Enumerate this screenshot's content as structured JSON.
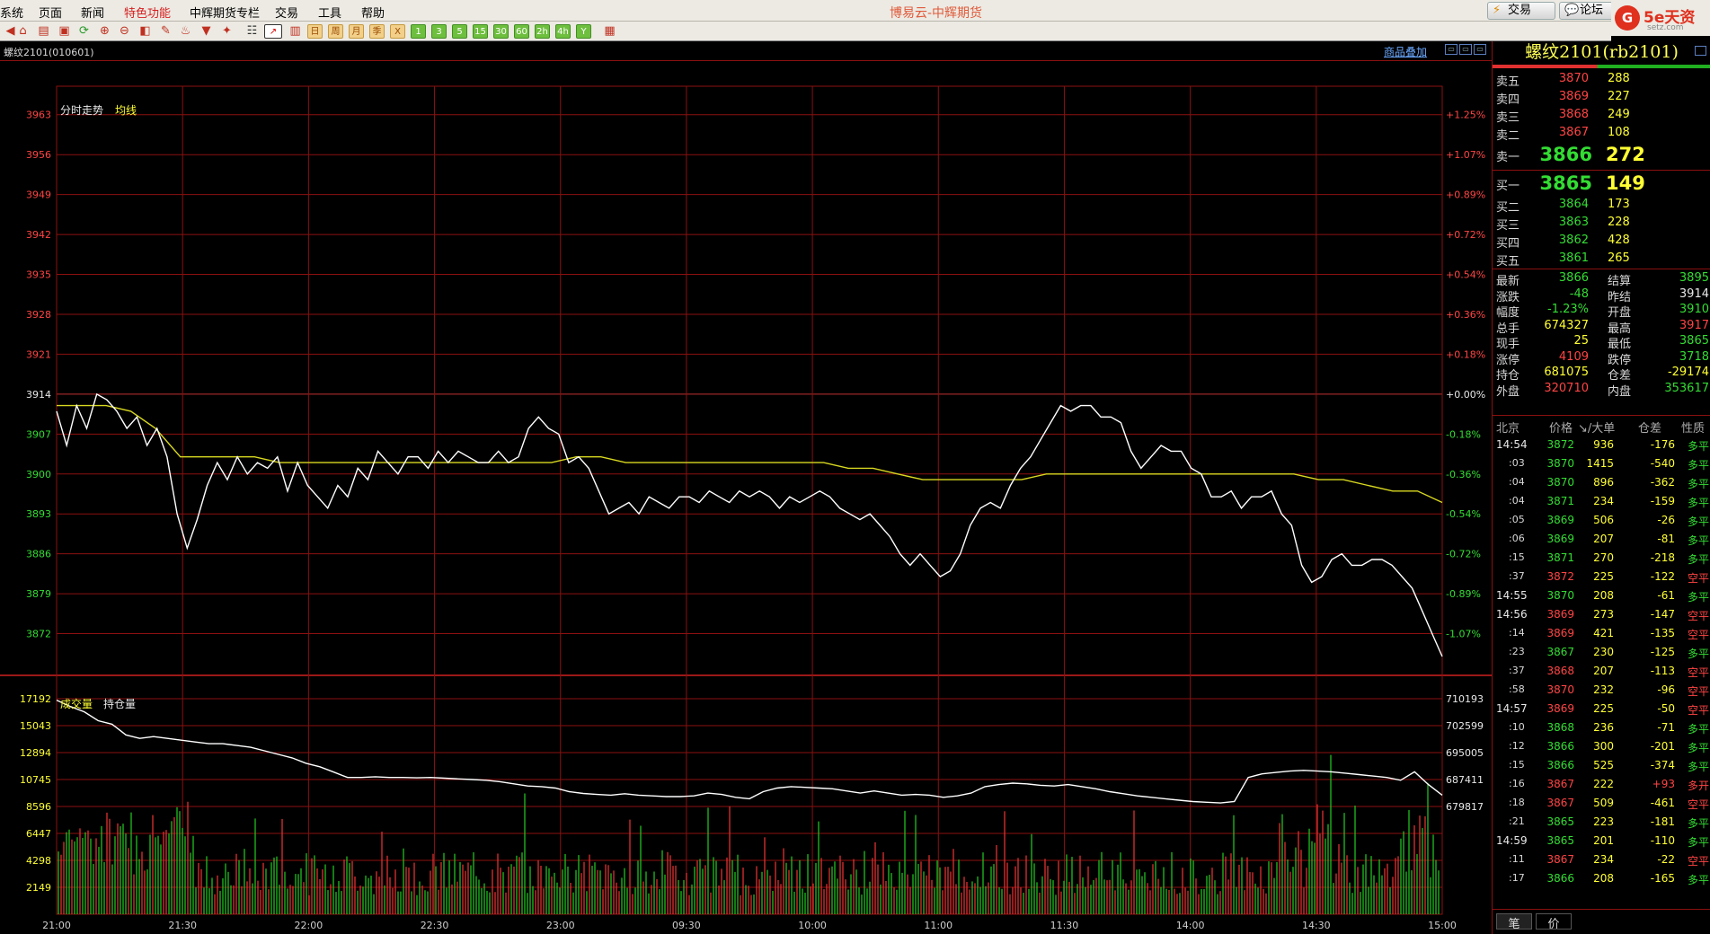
{
  "menu": {
    "items": [
      "系统",
      "页面",
      "新闻",
      "特色功能",
      "中辉期货专栏",
      "交易",
      "工具",
      "帮助"
    ],
    "app_title": "博易云-中辉期货",
    "trade_btn": "交易",
    "forum_btn": "论坛",
    "logo_brand": "5e天资",
    "logo_site": "setz.com"
  },
  "toolbar": {
    "period_buttons": [
      "日",
      "周",
      "月",
      "季",
      "X",
      "1",
      "3",
      "5",
      "15",
      "30",
      "60",
      "2h",
      "4h",
      "Y"
    ]
  },
  "chart": {
    "contract_code": "螺纹2101(010601)",
    "overlay_link": "商品叠加",
    "price_label": "分时走势",
    "avg_label": "均线",
    "volume_label": "成交量",
    "oi_label": "持仓量"
  },
  "chart_data": {
    "type": "line",
    "title": "",
    "price_axis_ticks": [
      "3963",
      "3956",
      "3949",
      "3942",
      "3935",
      "3928",
      "3921",
      "3914",
      "3907",
      "3900",
      "3893",
      "3886",
      "3879",
      "3872"
    ],
    "percent_axis_ticks": [
      "+1.25%",
      "+1.07%",
      "+0.89%",
      "+0.72%",
      "+0.54%",
      "+0.36%",
      "+0.18%",
      "+0.00%",
      "-0.18%",
      "-0.36%",
      "-0.54%",
      "-0.72%",
      "-0.89%",
      "-1.07%"
    ],
    "ylim": [
      3865,
      3968
    ],
    "prev_settle": 3914,
    "volume_axis_ticks": [
      "17192",
      "15043",
      "12894",
      "10745",
      "8596",
      "6447",
      "4298",
      "2149"
    ],
    "oi_axis_ticks": [
      "710193",
      "702599",
      "695005",
      "687411",
      "679817"
    ],
    "time_axis_ticks": [
      "21:00",
      "21:30",
      "22:00",
      "22:30",
      "23:00",
      "09:30",
      "10:00",
      "11:00",
      "11:30",
      "14:00",
      "14:30",
      "15:00"
    ],
    "series": [
      {
        "name": "分时走势",
        "values": [
          3911,
          3905,
          3912,
          3908,
          3914,
          3913,
          3911,
          3908,
          3910,
          3905,
          3908,
          3903,
          3893,
          3887,
          3892,
          3898,
          3902,
          3899,
          3903,
          3900,
          3902,
          3901,
          3903,
          3897,
          3902,
          3898,
          3896,
          3894,
          3898,
          3896,
          3901,
          3899,
          3904,
          3902,
          3900,
          3903,
          3903,
          3901,
          3904,
          3902,
          3904,
          3903,
          3902,
          3902,
          3904,
          3902,
          3903,
          3908,
          3910,
          3908,
          3907,
          3902,
          3903,
          3901,
          3897,
          3893,
          3894,
          3895,
          3893,
          3896,
          3895,
          3894,
          3896,
          3896,
          3895,
          3897,
          3896,
          3895,
          3897,
          3896,
          3897,
          3896,
          3894,
          3896,
          3895,
          3896,
          3897,
          3896,
          3894,
          3893,
          3892,
          3893,
          3891,
          3889,
          3886,
          3884,
          3886,
          3884,
          3882,
          3883,
          3886,
          3891,
          3894,
          3895,
          3894,
          3898,
          3901,
          3903,
          3906,
          3909,
          3912,
          3911,
          3912,
          3912,
          3910,
          3910,
          3909,
          3904,
          3901,
          3903,
          3905,
          3904,
          3904,
          3901,
          3900,
          3896,
          3896,
          3897,
          3894,
          3896,
          3896,
          3897,
          3893,
          3891,
          3884,
          3881,
          3882,
          3885,
          3886,
          3884,
          3884,
          3885,
          3885,
          3884,
          3882,
          3880,
          3876,
          3872,
          3868
        ]
      },
      {
        "name": "均线",
        "values": [
          3912,
          3912,
          3912,
          3911,
          3908,
          3903,
          3903,
          3903,
          3903,
          3902,
          3902,
          3902,
          3902,
          3902,
          3902,
          3902,
          3902,
          3902,
          3902,
          3902,
          3902,
          3903,
          3903,
          3902,
          3902,
          3902,
          3902,
          3902,
          3902,
          3902,
          3902,
          3902,
          3901,
          3901,
          3900,
          3899,
          3899,
          3899,
          3899,
          3899,
          3900,
          3900,
          3900,
          3900,
          3900,
          3900,
          3900,
          3900,
          3900,
          3900,
          3900,
          3899,
          3899,
          3898,
          3897,
          3897,
          3895
        ]
      },
      {
        "name": "持仓量",
        "values": [
          709800,
          708000,
          706500,
          704000,
          703000,
          700000,
          699000,
          699500,
          699000,
          698500,
          698000,
          697500,
          697500,
          697000,
          696500,
          695500,
          694500,
          693500,
          692000,
          691000,
          689500,
          688000,
          688000,
          688200,
          688000,
          688000,
          687900,
          688000,
          687800,
          687600,
          687400,
          687200,
          686800,
          686200,
          685600,
          685400,
          685000,
          684000,
          683500,
          683200,
          683000,
          683400,
          683000,
          682800,
          682600,
          682600,
          682800,
          683600,
          683200,
          682400,
          682000,
          684000,
          685000,
          685400,
          685200,
          685000,
          684800,
          684200,
          683600,
          684200,
          683600,
          683000,
          683200,
          683000,
          682400,
          682800,
          683600,
          685400,
          686000,
          686400,
          686200,
          685800,
          685600,
          686000,
          685400,
          684800,
          684000,
          683400,
          682800,
          682400,
          682000,
          681600,
          681200,
          681000,
          680800,
          681200,
          688000,
          689000,
          689400,
          689800,
          690000,
          689800,
          689600,
          689200,
          688800,
          688400,
          688000,
          687200,
          689600,
          686000,
          683000
        ]
      }
    ]
  },
  "panel": {
    "title": "螺纹2101(rb2101)",
    "asks": [
      {
        "label": "卖五",
        "price": "3870",
        "vol": "288"
      },
      {
        "label": "卖四",
        "price": "3869",
        "vol": "227"
      },
      {
        "label": "卖三",
        "price": "3868",
        "vol": "249"
      },
      {
        "label": "卖二",
        "price": "3867",
        "vol": "108"
      },
      {
        "label": "卖一",
        "price": "3866",
        "vol": "272"
      }
    ],
    "bids": [
      {
        "label": "买一",
        "price": "3865",
        "vol": "149"
      },
      {
        "label": "买二",
        "price": "3864",
        "vol": "173"
      },
      {
        "label": "买三",
        "price": "3863",
        "vol": "228"
      },
      {
        "label": "买四",
        "price": "3862",
        "vol": "428"
      },
      {
        "label": "买五",
        "price": "3861",
        "vol": "265"
      }
    ],
    "quote": [
      {
        "l1": "最新",
        "v1": "3866",
        "c1": "g",
        "l2": "结算",
        "v2": "3895",
        "c2": "g"
      },
      {
        "l1": "涨跌",
        "v1": "-48",
        "c1": "g",
        "l2": "昨结",
        "v2": "3914",
        "c2": "w"
      },
      {
        "l1": "幅度",
        "v1": "-1.23%",
        "c1": "g",
        "l2": "开盘",
        "v2": "3910",
        "c2": "g"
      },
      {
        "l1": "总手",
        "v1": "674327",
        "c1": "y",
        "l2": "最高",
        "v2": "3917",
        "c2": "r"
      },
      {
        "l1": "现手",
        "v1": "25",
        "c1": "y",
        "l2": "最低",
        "v2": "3865",
        "c2": "g"
      },
      {
        "l1": "涨停",
        "v1": "4109",
        "c1": "r",
        "l2": "跌停",
        "v2": "3718",
        "c2": "g"
      },
      {
        "l1": "持仓",
        "v1": "681075",
        "c1": "y",
        "l2": "仓差",
        "v2": "-29174",
        "c2": "y"
      },
      {
        "l1": "外盘",
        "v1": "320710",
        "c1": "r",
        "l2": "内盘",
        "v2": "353617",
        "c2": "g"
      }
    ],
    "tick_header": {
      "time": "北京",
      "price": "价格",
      "vol": "↘/大单",
      "oi": "仓差",
      "nature": "性质"
    },
    "ticks": [
      {
        "t": "14:54",
        "sub": false,
        "p": "3872",
        "pc": "g",
        "v": "936",
        "d": "-176",
        "dc": "y",
        "n": "多平",
        "nc": "g"
      },
      {
        "t": ":03",
        "sub": true,
        "p": "3870",
        "pc": "g",
        "v": "1415",
        "d": "-540",
        "dc": "y",
        "n": "多平",
        "nc": "g"
      },
      {
        "t": ":04",
        "sub": true,
        "p": "3870",
        "pc": "g",
        "v": "896",
        "d": "-362",
        "dc": "y",
        "n": "多平",
        "nc": "g"
      },
      {
        "t": ":04",
        "sub": true,
        "p": "3871",
        "pc": "g",
        "v": "234",
        "d": "-159",
        "dc": "y",
        "n": "多平",
        "nc": "g"
      },
      {
        "t": ":05",
        "sub": true,
        "p": "3869",
        "pc": "g",
        "v": "506",
        "d": "-26",
        "dc": "y",
        "n": "多平",
        "nc": "g"
      },
      {
        "t": ":06",
        "sub": true,
        "p": "3869",
        "pc": "g",
        "v": "207",
        "d": "-81",
        "dc": "y",
        "n": "多平",
        "nc": "g"
      },
      {
        "t": ":15",
        "sub": true,
        "p": "3871",
        "pc": "g",
        "v": "270",
        "d": "-218",
        "dc": "y",
        "n": "多平",
        "nc": "g"
      },
      {
        "t": ":37",
        "sub": true,
        "p": "3872",
        "pc": "r",
        "v": "225",
        "d": "-122",
        "dc": "y",
        "n": "空平",
        "nc": "r"
      },
      {
        "t": "14:55",
        "sub": false,
        "p": "3870",
        "pc": "g",
        "v": "208",
        "d": "-61",
        "dc": "y",
        "n": "多平",
        "nc": "g"
      },
      {
        "t": "14:56",
        "sub": false,
        "p": "3869",
        "pc": "r",
        "v": "273",
        "d": "-147",
        "dc": "y",
        "n": "空平",
        "nc": "r"
      },
      {
        "t": ":14",
        "sub": true,
        "p": "3869",
        "pc": "r",
        "v": "421",
        "d": "-135",
        "dc": "y",
        "n": "空平",
        "nc": "r"
      },
      {
        "t": ":23",
        "sub": true,
        "p": "3867",
        "pc": "g",
        "v": "230",
        "d": "-125",
        "dc": "y",
        "n": "多平",
        "nc": "g"
      },
      {
        "t": ":37",
        "sub": true,
        "p": "3868",
        "pc": "r",
        "v": "207",
        "d": "-113",
        "dc": "y",
        "n": "空平",
        "nc": "r"
      },
      {
        "t": ":58",
        "sub": true,
        "p": "3870",
        "pc": "r",
        "v": "232",
        "d": "-96",
        "dc": "y",
        "n": "空平",
        "nc": "r"
      },
      {
        "t": "14:57",
        "sub": false,
        "p": "3869",
        "pc": "r",
        "v": "225",
        "d": "-50",
        "dc": "y",
        "n": "空平",
        "nc": "r"
      },
      {
        "t": ":10",
        "sub": true,
        "p": "3868",
        "pc": "g",
        "v": "236",
        "d": "-71",
        "dc": "y",
        "n": "多平",
        "nc": "g"
      },
      {
        "t": ":12",
        "sub": true,
        "p": "3866",
        "pc": "g",
        "v": "300",
        "d": "-201",
        "dc": "y",
        "n": "多平",
        "nc": "g"
      },
      {
        "t": ":15",
        "sub": true,
        "p": "3866",
        "pc": "g",
        "v": "525",
        "d": "-374",
        "dc": "y",
        "n": "多平",
        "nc": "g"
      },
      {
        "t": ":16",
        "sub": true,
        "p": "3867",
        "pc": "r",
        "v": "222",
        "d": "+93",
        "dc": "r",
        "n": "多开",
        "nc": "r"
      },
      {
        "t": ":18",
        "sub": true,
        "p": "3867",
        "pc": "r",
        "v": "509",
        "d": "-461",
        "dc": "y",
        "n": "空平",
        "nc": "r"
      },
      {
        "t": ":21",
        "sub": true,
        "p": "3865",
        "pc": "g",
        "v": "223",
        "d": "-181",
        "dc": "y",
        "n": "多平",
        "nc": "g"
      },
      {
        "t": "14:59",
        "sub": false,
        "p": "3865",
        "pc": "g",
        "v": "201",
        "d": "-110",
        "dc": "y",
        "n": "多平",
        "nc": "g"
      },
      {
        "t": ":11",
        "sub": true,
        "p": "3867",
        "pc": "r",
        "v": "234",
        "d": "-22",
        "dc": "y",
        "n": "空平",
        "nc": "r"
      },
      {
        "t": ":17",
        "sub": true,
        "p": "3866",
        "pc": "g",
        "v": "208",
        "d": "-165",
        "dc": "y",
        "n": "多平",
        "nc": "g"
      }
    ],
    "tabs": [
      "笔",
      "价"
    ]
  }
}
